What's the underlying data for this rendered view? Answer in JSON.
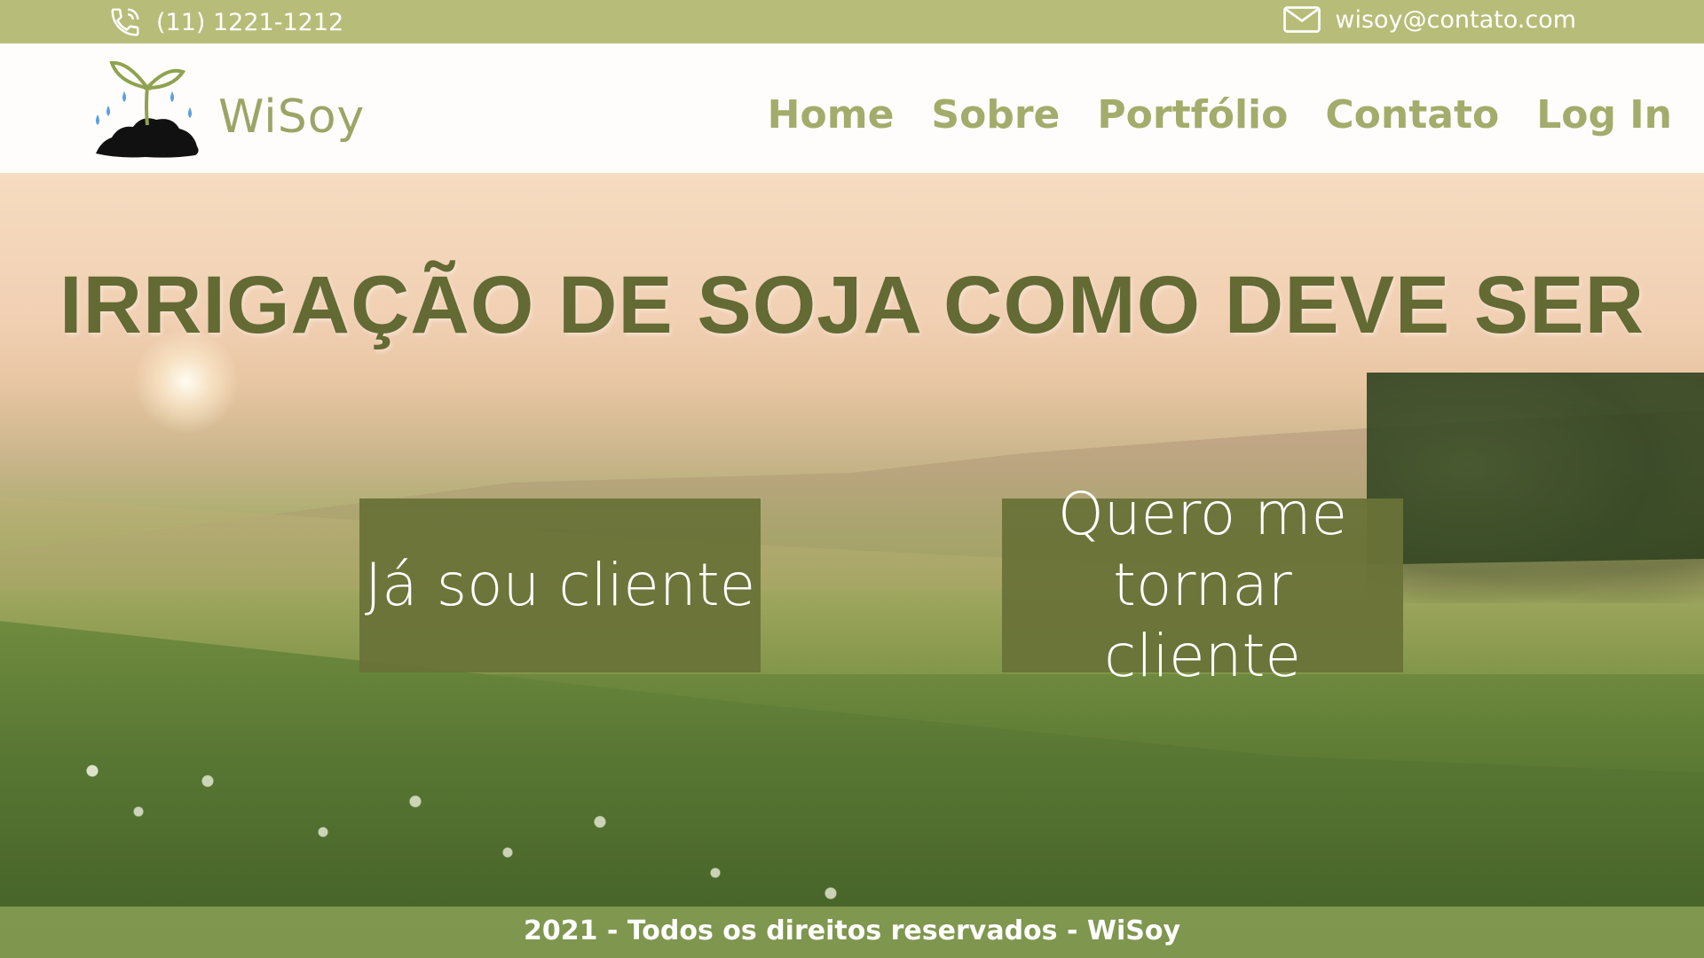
{
  "topbar": {
    "phone": "(11) 1221-1212",
    "phone_icon": "phone-icon",
    "email": "wisoy@contato.com",
    "email_icon": "mail-icon"
  },
  "header": {
    "brand": "WiSoy",
    "logo_icon": "soy-sprout-logo",
    "nav": [
      "Home",
      "Sobre",
      "Portfólio",
      "Contato",
      "Log In"
    ]
  },
  "hero": {
    "title": "IRRIGAÇÃO DE SOJA COMO DEVE SER",
    "buttons": {
      "client": "Já sou cliente",
      "become_line1": "Quero me",
      "become_line2": "tornar cliente"
    }
  },
  "footer": {
    "text": "2021 - Todos os direitos reservados - WiSoy"
  },
  "colors": {
    "topbar": "#b7bd78",
    "nav": "#a3ac6b",
    "title": "#636a33",
    "button": "#697238",
    "footer": "#89a056"
  }
}
